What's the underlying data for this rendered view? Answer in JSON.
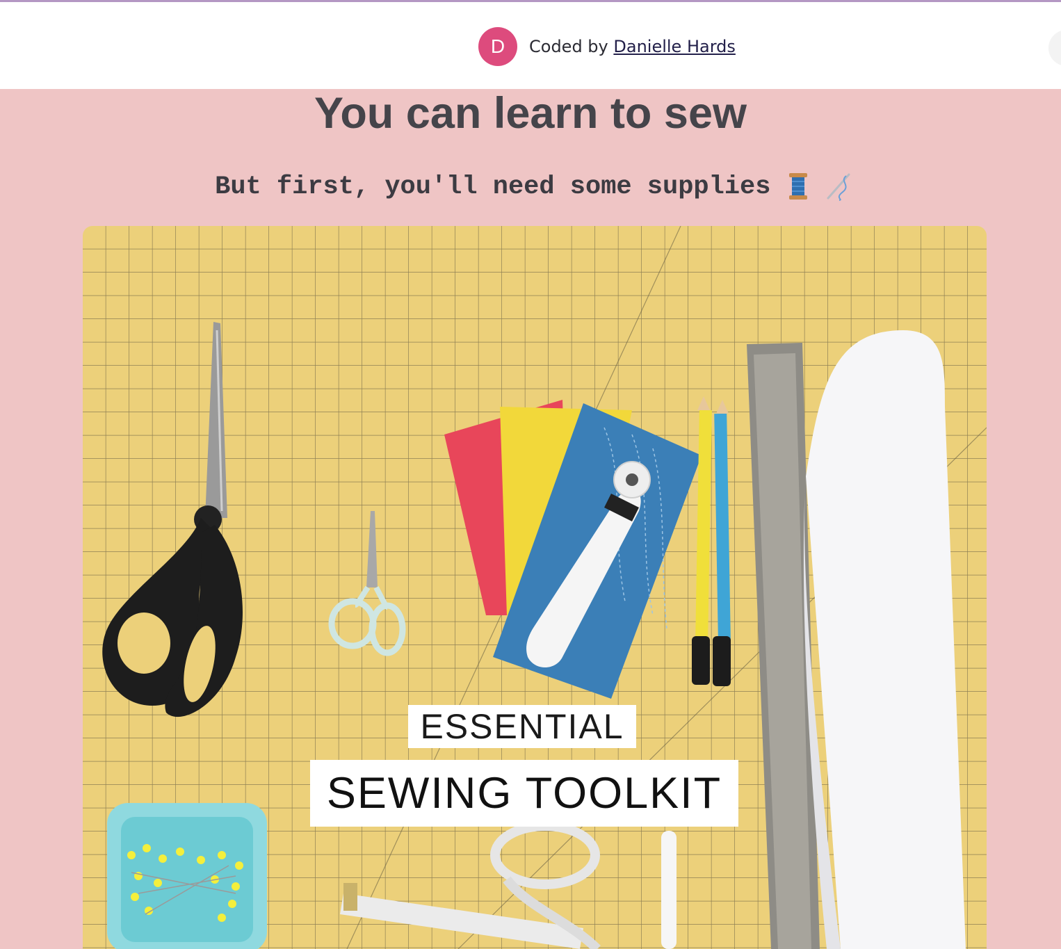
{
  "header": {
    "avatar_letter": "D",
    "coded_by_prefix": "Coded by",
    "author_name": "Danielle Hards"
  },
  "main": {
    "title": "You can learn to sew",
    "subtitle": "But first, you'll need some supplies",
    "icons": [
      "spool-of-thread-icon",
      "needle-and-thread-icon"
    ]
  },
  "image": {
    "label_line_1": "ESSENTIAL",
    "label_line_2": "SEWING TOOLKIT",
    "depicts": [
      "fabric-scissors",
      "embroidery-scissors",
      "fabric-swatches",
      "rotary-cutter",
      "fabric-pencils",
      "ruler",
      "paper-roll",
      "pin-cushion",
      "tape-measure"
    ]
  },
  "colors": {
    "background": "#efc5c5",
    "header": "#ffffff",
    "avatar": "#dd4b7d",
    "title": "#45444a",
    "cutting_mat": "#ecd07a"
  }
}
